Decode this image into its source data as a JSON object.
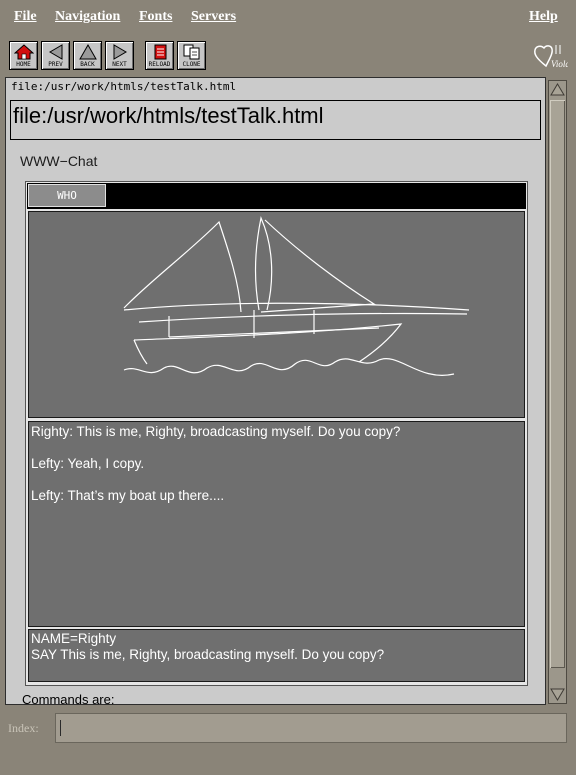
{
  "menu": {
    "file": "File",
    "navigation": "Navigation",
    "fonts": "Fonts",
    "servers": "Servers",
    "help": "Help"
  },
  "toolbar": {
    "home": "HOME",
    "prev": "PREV",
    "back": "BACK",
    "next": "NEXT",
    "reload": "RELOAD",
    "clone": "CLONE",
    "logo": "Viola"
  },
  "location": {
    "small": "file:/usr/work/htmls/testTalk.html",
    "big": "file:/usr/work/htmls/testTalk.html"
  },
  "app": {
    "title": "WWW−Chat",
    "who_button": "WHO",
    "messages": [
      "Righty: This is me, Righty, broadcasting myself. Do you copy?",
      "Lefty: Yeah, I copy.",
      "Lefty: That’s my boat up there...."
    ],
    "outgoing": {
      "name": "NAME=Righty",
      "say": "SAY This is me, Righty, broadcasting myself. Do you copy?"
    },
    "commands_label": "Commands are:"
  },
  "index": {
    "label": "Index:",
    "value": ""
  },
  "colors": {
    "chrome": "#8a8478",
    "page": "#cbcbcb",
    "panel": "#6f6f6f",
    "accent": "#c8102e"
  }
}
